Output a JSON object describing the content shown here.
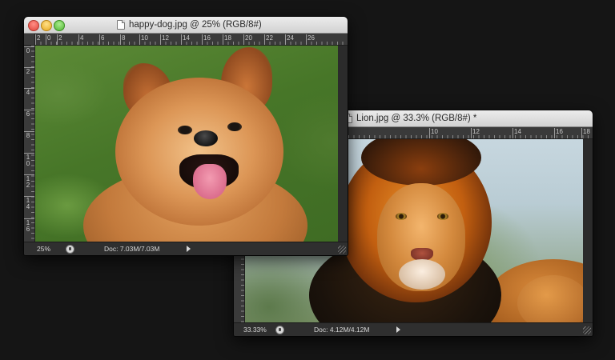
{
  "windows": {
    "dog": {
      "title": "happy-dog.jpg @ 25% (RGB/8#)",
      "ruler_top": [
        "2",
        "0",
        "2",
        "4",
        "6",
        "8",
        "10",
        "12",
        "14",
        "16",
        "18",
        "20",
        "22",
        "24",
        "26"
      ],
      "ruler_left": [
        "0",
        "2",
        "4",
        "6",
        "8",
        "10",
        "12",
        "14",
        "16"
      ],
      "zoom": "25%",
      "doc_size": "Doc: 7.03M/7.03M"
    },
    "lion": {
      "title": "Lion.jpg @ 33.3% (RGB/8#) *",
      "ruler_top": [
        "10",
        "12",
        "14",
        "16",
        "18"
      ],
      "zoom": "33.33%",
      "doc_size": "Doc: 4.12M/4.12M"
    }
  },
  "colors": {
    "desktop": "#151515",
    "window_chrome": "#2b2b2b",
    "titlebar": "#d2d2d2",
    "close": "#e0443a",
    "minimize": "#e7a91e",
    "zoom": "#4fb432"
  },
  "icons": {
    "close": "close-icon",
    "minimize": "minimize-icon",
    "zoom": "zoom-icon",
    "document": "document-icon",
    "status": "status-info-icon",
    "menu_arrow": "menu-arrow-icon",
    "resize": "resize-grip-icon"
  }
}
